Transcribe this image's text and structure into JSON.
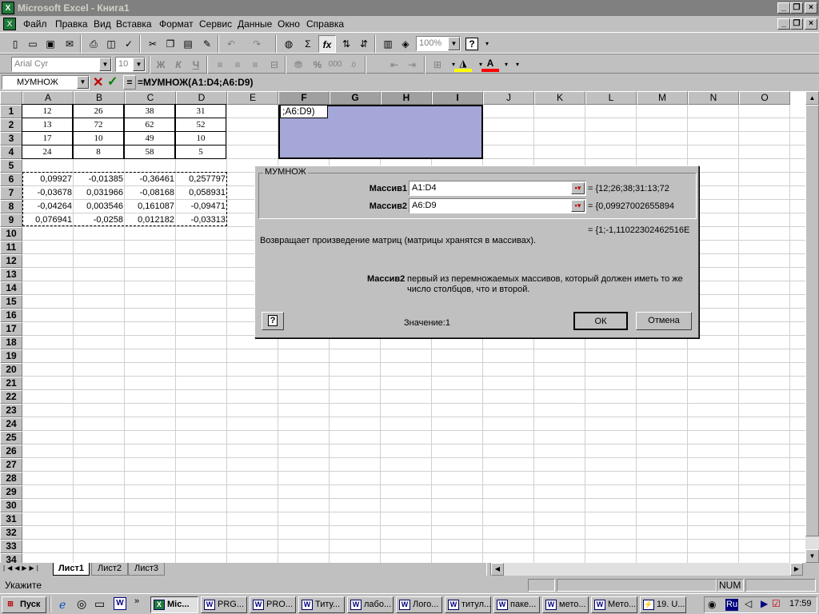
{
  "title_bar": {
    "title": "Microsoft Excel - Книга1",
    "app_icon": "X",
    "minimize": "_",
    "restore": "❐",
    "close": "×"
  },
  "menu": {
    "items": [
      "Файл",
      "Правка",
      "Вид",
      "Вставка",
      "Формат",
      "Сервис",
      "Данные",
      "Окно",
      "Справка"
    ]
  },
  "toolbar": {
    "zoom": "100%",
    "autosum": "Σ",
    "function": "fx",
    "help": "?"
  },
  "format_toolbar": {
    "font": "Arial Cyr",
    "size": "10",
    "bold": "Ж",
    "italic": "К",
    "underline": "Ч",
    "percent": "%",
    "thousands": "000",
    "font_color_letter": "A"
  },
  "formula_bar": {
    "name_box": "МУМНОЖ",
    "cancel": "✕",
    "enter": "✓",
    "equals": "=",
    "formula": "=МУМНОЖ(A1:D4;A6:D9)"
  },
  "grid": {
    "columns": [
      "A",
      "B",
      "C",
      "D",
      "E",
      "F",
      "G",
      "H",
      "I",
      "J",
      "K",
      "L",
      "M",
      "N",
      "O"
    ],
    "rows": [
      "1",
      "2",
      "3",
      "4",
      "5",
      "6",
      "7",
      "8",
      "9",
      "10",
      "11",
      "12",
      "13",
      "14",
      "15",
      "16",
      "17",
      "18",
      "19",
      "20",
      "21",
      "22",
      "23",
      "24",
      "25",
      "26",
      "27",
      "28",
      "29",
      "30",
      "31",
      "32",
      "33",
      "34"
    ],
    "matrix1": [
      [
        "12",
        "26",
        "38",
        "31"
      ],
      [
        "13",
        "72",
        "62",
        "52"
      ],
      [
        "17",
        "10",
        "49",
        "10"
      ],
      [
        "24",
        "8",
        "58",
        "5"
      ]
    ],
    "matrix2": [
      [
        "0,09927",
        "-0,01385",
        "-0,36461",
        "0,257797"
      ],
      [
        "-0,03678",
        "0,031966",
        "-0,08168",
        "0,058931"
      ],
      [
        "-0,04264",
        "0,003546",
        "0,161087",
        "-0,09471"
      ],
      [
        "0,076941",
        "-0,0258",
        "0,012182",
        "-0,03313"
      ]
    ],
    "f1_edit": ";A6:D9)"
  },
  "dialog": {
    "title": "МУМНОЖ",
    "arg1_label": "Массив1",
    "arg1_value": "A1:D4",
    "arg1_result": "= {12;26;38;31:13;72",
    "arg2_label": "Массив2",
    "arg2_value": "A6:D9",
    "arg2_result": "= {0,09927002655894",
    "result": "= {1;-1,11022302462516E",
    "description": "Возвращает произведение матриц (матрицы хранятся в массивах).",
    "arg_help_name": "Массив2",
    "arg_help_line1": "первый из перемножаемых массивов, который должен иметь то же",
    "arg_help_line2": "число столбцов, что и второй.",
    "value_label": "Значение:1",
    "ok": "ОК",
    "cancel": "Отмена",
    "help_icon": "?"
  },
  "sheets": [
    "Лист1",
    "Лист2",
    "Лист3"
  ],
  "status": {
    "mode": "Укажите",
    "num": "NUM"
  },
  "taskbar": {
    "start": "Пуск",
    "tasks": [
      "Mic...",
      "PRG...",
      "PRO...",
      "Титу...",
      "лабо...",
      "Лого...",
      "титул...",
      "паке...",
      "мето...",
      "Мето...",
      "19. U..."
    ],
    "lang": "Ru",
    "clock": "17:59"
  }
}
